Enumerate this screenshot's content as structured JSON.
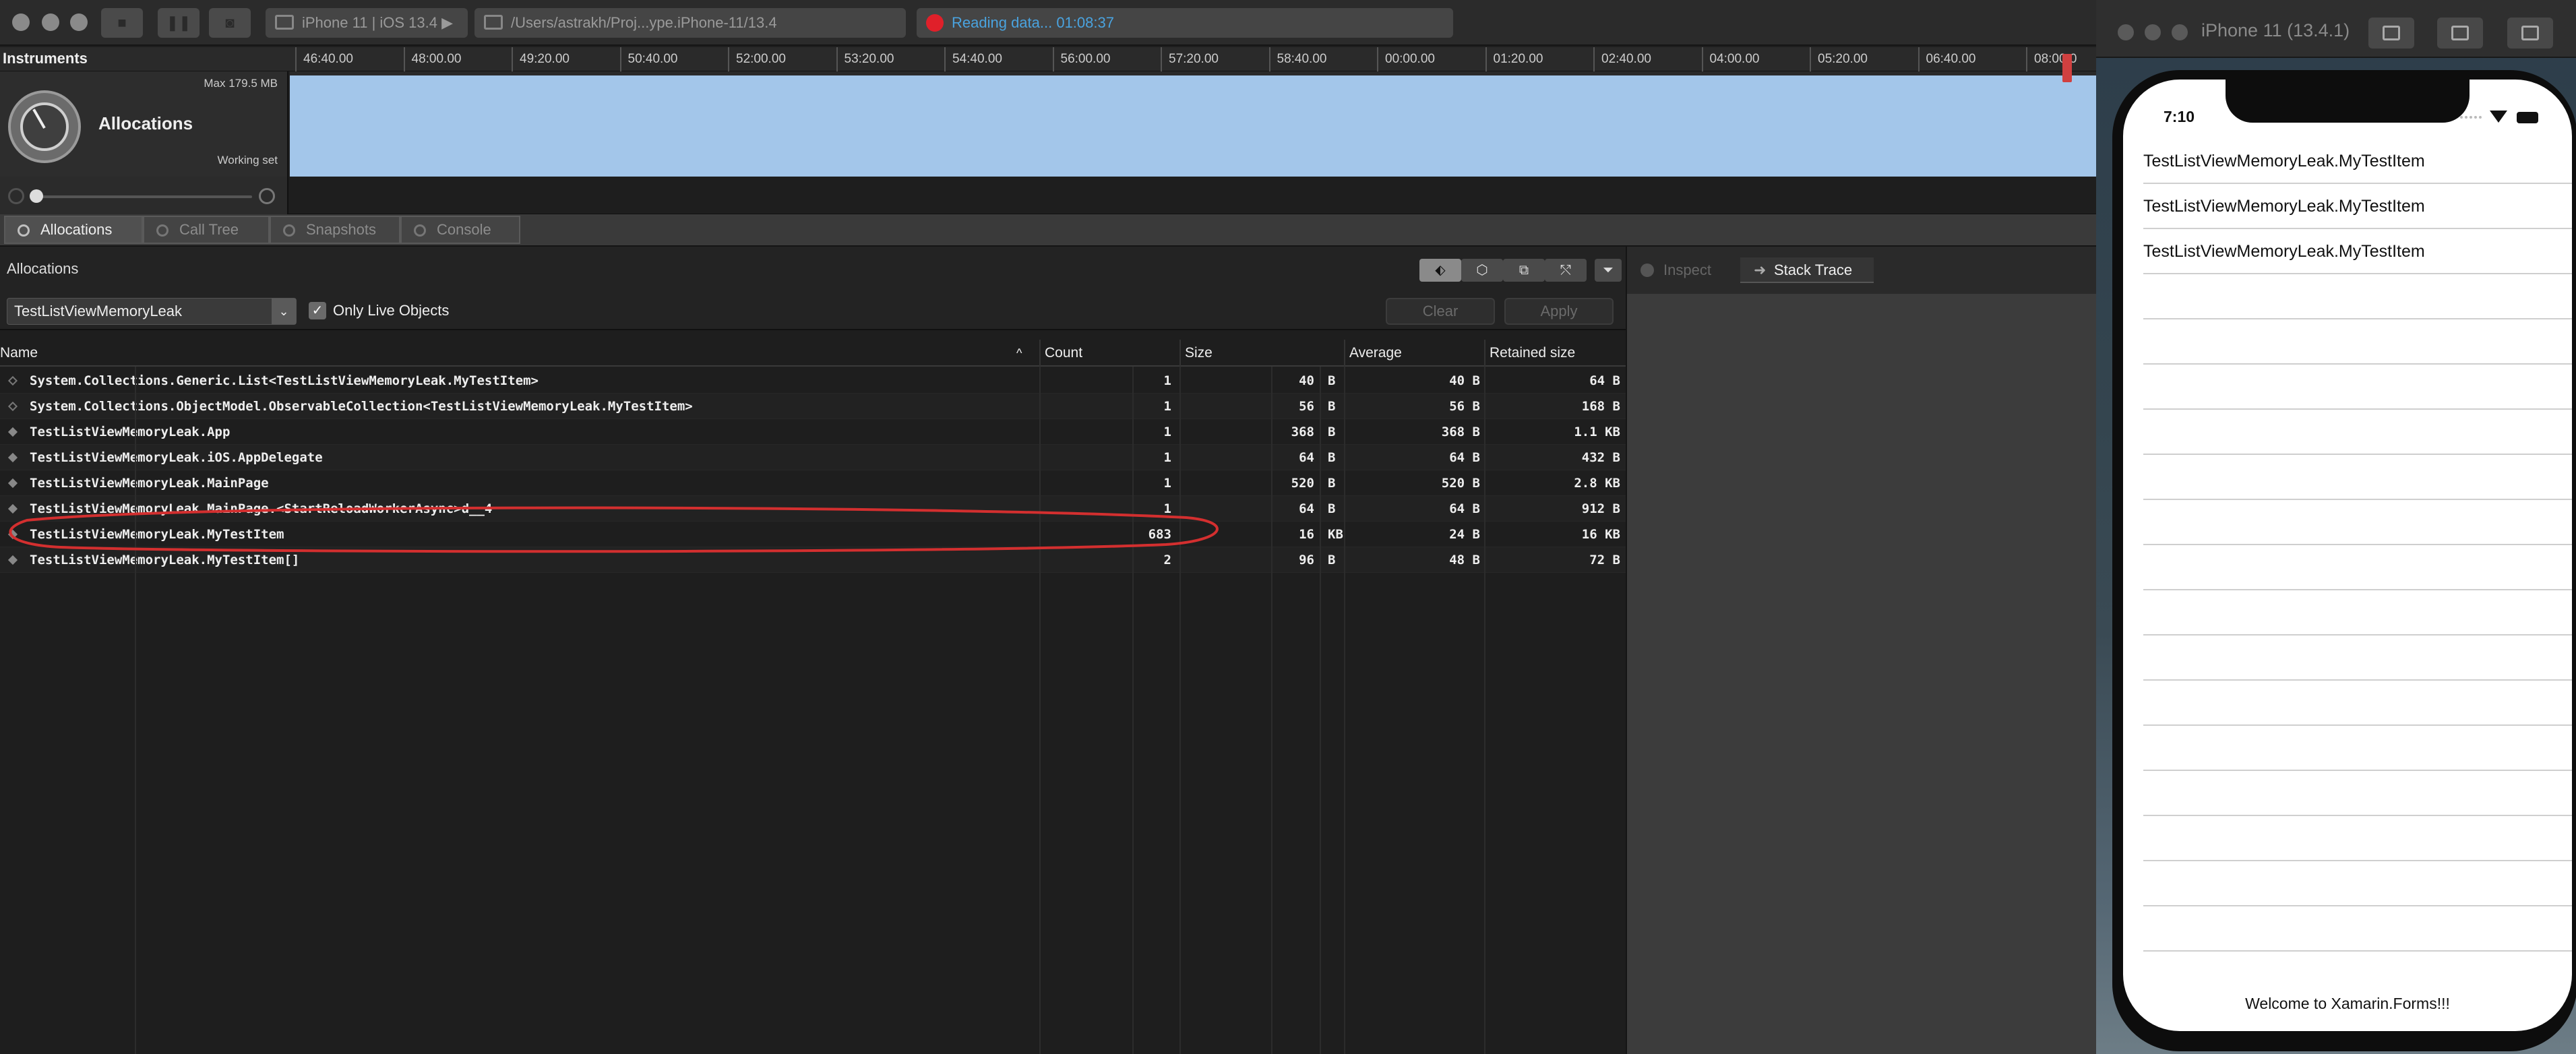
{
  "instruments": {
    "device_target": "iPhone 11 | iOS 13.4 ▶",
    "app_path": "/Users/astrakh/Proj...ype.iPhone-11/13.4",
    "status": "Reading data... 01:08:37",
    "instruments_label": "Instruments",
    "timeline_ticks": [
      "46:40.00",
      "48:00.00",
      "49:20.00",
      "50:40.00",
      "52:00.00",
      "53:20.00",
      "54:40.00",
      "56:00.00",
      "57:20.00",
      "58:40.00",
      "00:00.00",
      "01:20.00",
      "02:40.00",
      "04:00.00",
      "05:20.00",
      "06:40.00",
      "08:00.0"
    ],
    "track": {
      "name": "Allocations",
      "max_label": "Max 179.5 MB",
      "working_set_label": "Working set",
      "graph_color": "#a3c6ea"
    },
    "tabs": [
      "Allocations",
      "Call Tree",
      "Snapshots",
      "Console"
    ],
    "active_tab": "Allocations",
    "detail_title": "Allocations",
    "inspector_tabs": {
      "inspect": "Inspect",
      "stack_trace": "Stack Trace"
    },
    "filter": {
      "target": "TestListViewMemoryLeak",
      "only_live_objects": "Only Live Objects",
      "only_live_checked": true,
      "clear_label": "Clear",
      "apply_label": "Apply"
    },
    "table": {
      "columns": [
        "Name",
        "Count",
        "Size",
        "Average",
        "Retained size"
      ],
      "rows": [
        {
          "name": "System.Collections.Generic.List<TestListViewMemoryLeak.MyTestItem>",
          "count": "1",
          "size": "40",
          "size_unit": "B",
          "average": "40 B",
          "retained": "64 B",
          "icon": "hollow"
        },
        {
          "name": "System.Collections.ObjectModel.ObservableCollection<TestListViewMemoryLeak.MyTestItem>",
          "count": "1",
          "size": "56",
          "size_unit": "B",
          "average": "56 B",
          "retained": "168 B",
          "icon": "hollow"
        },
        {
          "name": "TestListViewMemoryLeak.App",
          "count": "1",
          "size": "368",
          "size_unit": "B",
          "average": "368 B",
          "retained": "1.1 KB",
          "icon": "solid"
        },
        {
          "name": "TestListViewMemoryLeak.iOS.AppDelegate",
          "count": "1",
          "size": "64",
          "size_unit": "B",
          "average": "64 B",
          "retained": "432 B",
          "icon": "solid"
        },
        {
          "name": "TestListViewMemoryLeak.MainPage",
          "count": "1",
          "size": "520",
          "size_unit": "B",
          "average": "520 B",
          "retained": "2.8 KB",
          "icon": "solid"
        },
        {
          "name": "TestListViewMemoryLeak.MainPage.<StartReloadWorkerAsync>d__4",
          "count": "1",
          "size": "64",
          "size_unit": "B",
          "average": "64 B",
          "retained": "912 B",
          "icon": "solid"
        },
        {
          "name": "TestListViewMemoryLeak.MyTestItem",
          "count": "683",
          "size": "16",
          "size_unit": "KB",
          "average": "24 B",
          "retained": "16 KB",
          "icon": "solid",
          "highlighted": true
        },
        {
          "name": "TestListViewMemoryLeak.MyTestItem[]",
          "count": "2",
          "size": "96",
          "size_unit": "B",
          "average": "48 B",
          "retained": "72 B",
          "icon": "solid"
        }
      ]
    },
    "annotation_color": "#d32f2f"
  },
  "simulator": {
    "title": "iPhone 11 (13.4.1)",
    "clock": "7:10",
    "list_items": [
      "TestListViewMemoryLeak.MyTestItem",
      "TestListViewMemoryLeak.MyTestItem",
      "TestListViewMemoryLeak.MyTestItem"
    ],
    "footer": "Welcome to Xamarin.Forms!!!"
  }
}
